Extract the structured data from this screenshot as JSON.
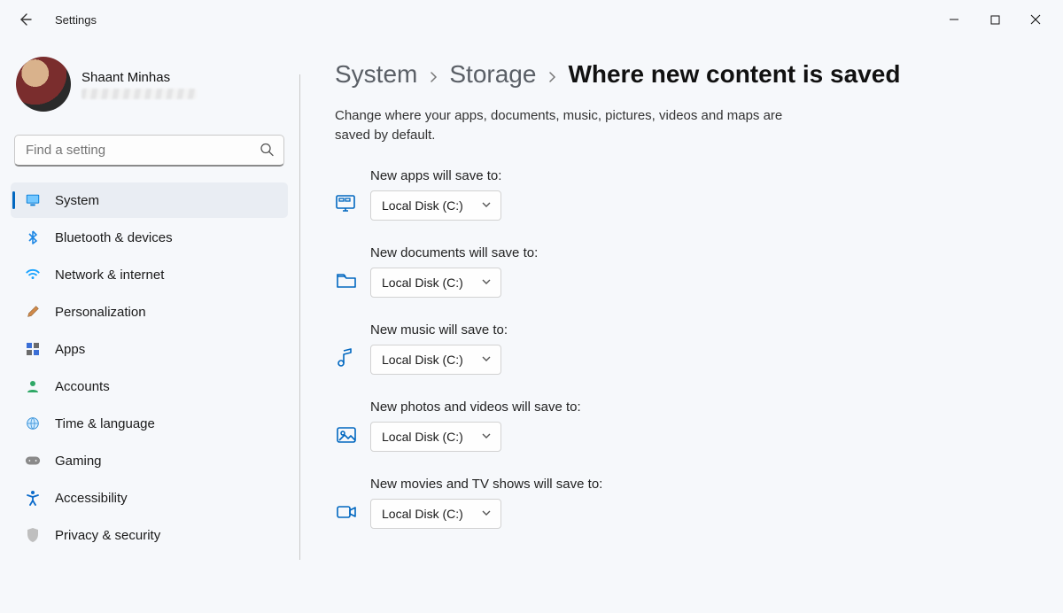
{
  "app": {
    "title": "Settings"
  },
  "profile": {
    "name": "Shaant Minhas"
  },
  "search": {
    "placeholder": "Find a setting"
  },
  "sidebar": {
    "items": [
      {
        "id": "system",
        "label": "System",
        "selected": true,
        "icon": "monitor"
      },
      {
        "id": "bluetooth",
        "label": "Bluetooth & devices",
        "selected": false,
        "icon": "bluetooth"
      },
      {
        "id": "network",
        "label": "Network & internet",
        "selected": false,
        "icon": "wifi"
      },
      {
        "id": "personalization",
        "label": "Personalization",
        "selected": false,
        "icon": "brush"
      },
      {
        "id": "apps",
        "label": "Apps",
        "selected": false,
        "icon": "apps"
      },
      {
        "id": "accounts",
        "label": "Accounts",
        "selected": false,
        "icon": "person"
      },
      {
        "id": "time",
        "label": "Time & language",
        "selected": false,
        "icon": "globe"
      },
      {
        "id": "gaming",
        "label": "Gaming",
        "selected": false,
        "icon": "gamepad"
      },
      {
        "id": "accessibility",
        "label": "Accessibility",
        "selected": false,
        "icon": "accessibility"
      },
      {
        "id": "privacy",
        "label": "Privacy & security",
        "selected": false,
        "icon": "shield"
      }
    ]
  },
  "breadcrumb": {
    "parts": [
      "System",
      "Storage"
    ],
    "current": "Where new content is saved"
  },
  "description": "Change where your apps, documents, music, pictures, videos and maps are saved by default.",
  "settings": [
    {
      "id": "apps",
      "label": "New apps will save to:",
      "value": "Local Disk (C:)",
      "icon": "monitor-app"
    },
    {
      "id": "documents",
      "label": "New documents will save to:",
      "value": "Local Disk (C:)",
      "icon": "folder"
    },
    {
      "id": "music",
      "label": "New music will save to:",
      "value": "Local Disk (C:)",
      "icon": "music"
    },
    {
      "id": "photosvideos",
      "label": "New photos and videos will save to:",
      "value": "Local Disk (C:)",
      "icon": "picture"
    },
    {
      "id": "movies",
      "label": "New movies and TV shows will save to:",
      "value": "Local Disk (C:)",
      "icon": "video"
    }
  ],
  "colors": {
    "accent": "#0067c0"
  }
}
